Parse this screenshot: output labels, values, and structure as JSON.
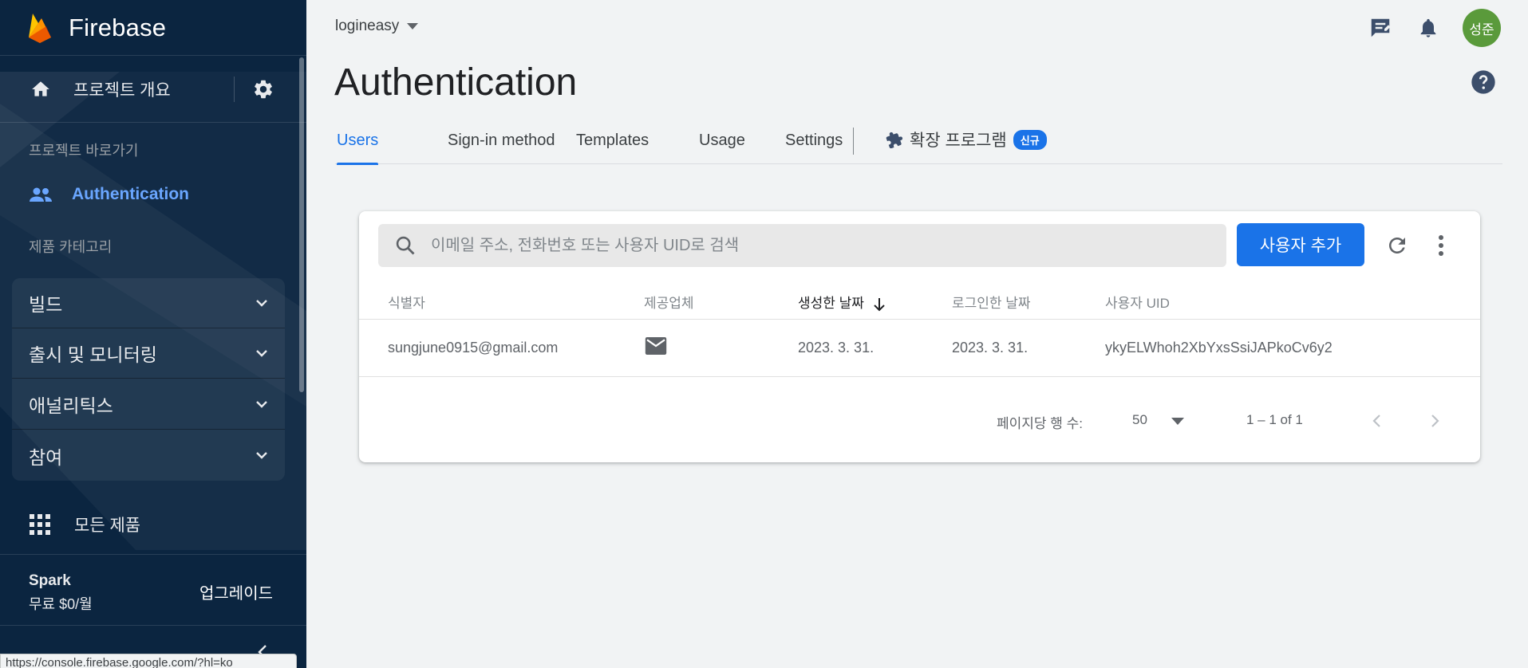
{
  "brand": {
    "name": "Firebase"
  },
  "sidebar": {
    "overview_label": "프로젝트 개요",
    "shortcuts_label": "프로젝트 바로가기",
    "active_item": "Authentication",
    "catalog_label": "제품 카테고리",
    "categories": [
      {
        "label": "빌드"
      },
      {
        "label": "출시 및 모니터링"
      },
      {
        "label": "애널리틱스"
      },
      {
        "label": "참여"
      }
    ],
    "all_products_label": "모든 제품",
    "plan": {
      "name": "Spark",
      "price": "무료 $0/월",
      "upgrade_label": "업그레이드"
    },
    "status_url": "https://console.firebase.google.com/?hl=ko"
  },
  "header": {
    "project": "logineasy",
    "avatar_text": "성준",
    "title": "Authentication"
  },
  "tabs": [
    {
      "label": "Users",
      "active": true
    },
    {
      "label": "Sign-in method"
    },
    {
      "label": "Templates"
    },
    {
      "label": "Usage"
    },
    {
      "label": "Settings"
    }
  ],
  "extensions_tab": {
    "label": "확장 프로그램",
    "badge": "신규"
  },
  "users_table": {
    "search_placeholder": "이메일 주소, 전화번호 또는 사용자 UID로 검색",
    "add_user_label": "사용자 추가",
    "columns": [
      "식별자",
      "제공업체",
      "생성한 날짜",
      "로그인한 날짜",
      "사용자 UID"
    ],
    "sorted_column": "생성한 날짜",
    "rows": [
      {
        "identifier": "sungjune0915@gmail.com",
        "provider": "email",
        "created": "2023. 3. 31.",
        "signed_in": "2023. 3. 31.",
        "uid": "ykyELWhoh2XbYxsSsiJAPkoCv6y2"
      }
    ],
    "pagination": {
      "rows_per_page_label": "페이지당 행 수:",
      "rows_per_page": "50",
      "range": "1 – 1 of 1"
    }
  },
  "colors": {
    "sidebar_bg": "#0b2540",
    "accent": "#1a73e8",
    "active_nav": "#6aa6ff",
    "avatar": "#5a9a3b"
  }
}
